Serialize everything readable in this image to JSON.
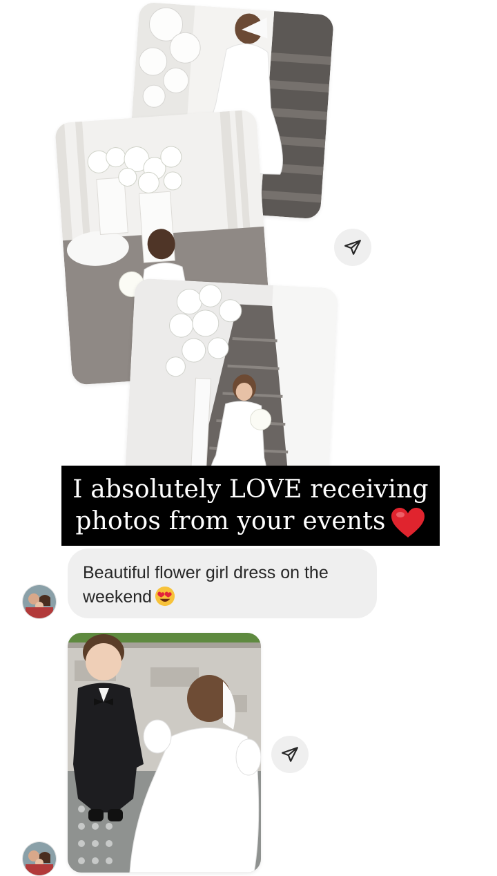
{
  "story": {
    "caption_line1": "I absolutely LOVE receiving",
    "caption_line2": "photos from your events",
    "caption_emoji": "red-heart"
  },
  "messages": [
    {
      "type": "photo-collage",
      "photos": [
        "girl-stairs-back",
        "girl-flowers-bouquet",
        "girl-on-stairs"
      ],
      "action_icon": "send-icon"
    },
    {
      "type": "text",
      "text": "Beautiful flower girl dress on the weekend",
      "emoji": "heart-eyes-emoji",
      "sender_avatar": "avatar"
    },
    {
      "type": "photo",
      "photo": "boy-tuxedo-and-flower-girl",
      "action_icon": "send-icon",
      "sender_avatar": "avatar"
    }
  ],
  "colors": {
    "background": "#ffffff",
    "bubble": "#efefef",
    "text": "#262626",
    "caption_bg": "#000000",
    "heart": "#e0242e"
  }
}
